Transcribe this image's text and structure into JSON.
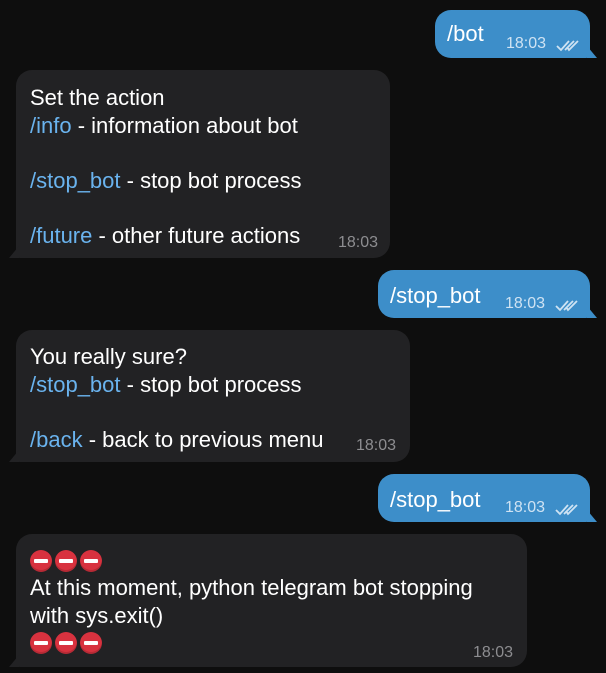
{
  "messages": [
    {
      "direction": "outgoing",
      "text": "/bot",
      "time": "18:03",
      "status_icon": "double-check-icon"
    },
    {
      "direction": "incoming",
      "lines": [
        {
          "plain": "Set the action"
        },
        {
          "cmd": "/info",
          "rest": " - information about bot"
        },
        {
          "blank": true
        },
        {
          "cmd": "/stop_bot",
          "rest": " - stop bot process"
        },
        {
          "blank": true
        },
        {
          "cmd": "/future",
          "rest": " - other future actions"
        }
      ],
      "time": "18:03"
    },
    {
      "direction": "outgoing",
      "text": "/stop_bot",
      "time": "18:03",
      "status_icon": "double-check-icon"
    },
    {
      "direction": "incoming",
      "lines": [
        {
          "plain": "You really sure?"
        },
        {
          "cmd": "/stop_bot",
          "rest": " - stop bot process"
        },
        {
          "blank": true
        },
        {
          "cmd": "/back",
          "rest": " - back to previous menu"
        }
      ],
      "time": "18:03"
    },
    {
      "direction": "outgoing",
      "text": "/stop_bot",
      "time": "18:03",
      "status_icon": "double-check-icon"
    },
    {
      "direction": "incoming",
      "emoji": "no-entry-icon",
      "emoji_count": 3,
      "lines": [
        {
          "plain": "At this moment, python telegram bot stopping"
        },
        {
          "plain": "with sys.exit()"
        }
      ],
      "time": "18:03"
    }
  ],
  "colors": {
    "background": "#0e0e0e",
    "outgoing_bubble": "#3d8ec9",
    "incoming_bubble": "#222224",
    "command_link": "#6ab3ee",
    "no_entry_red": "#d8323f"
  }
}
